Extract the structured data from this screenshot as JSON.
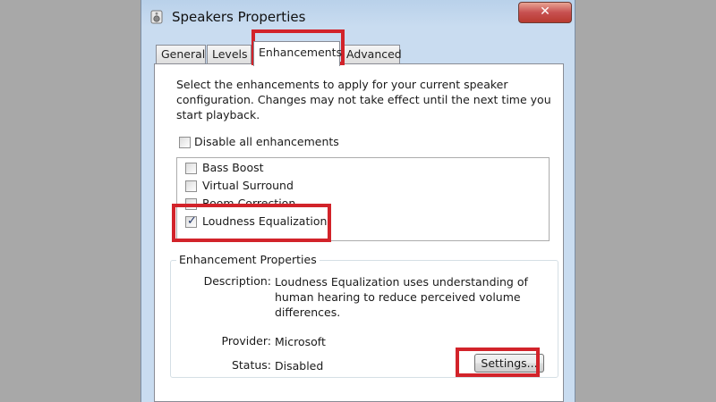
{
  "window": {
    "title": "Speakers Properties",
    "close_glyph": "✕"
  },
  "tabs": [
    {
      "label": "General",
      "active": false
    },
    {
      "label": "Levels",
      "active": false
    },
    {
      "label": "Enhancements",
      "active": true
    },
    {
      "label": "Advanced",
      "active": false
    }
  ],
  "intro_text": "Select the enhancements to apply for your current speaker configuration. Changes may not take effect until the next time you start playback.",
  "disable_all": {
    "label": "Disable all enhancements",
    "checked": false
  },
  "enhancements": [
    {
      "label": "Bass Boost",
      "checked": false
    },
    {
      "label": "Virtual Surround",
      "checked": false
    },
    {
      "label": "Room Correction",
      "checked": false
    },
    {
      "label": "Loudness Equalization",
      "checked": true
    }
  ],
  "properties": {
    "group_title": "Enhancement Properties",
    "description_label": "Description:",
    "description_value": "Loudness Equalization uses understanding of human hearing to reduce perceived volume differences.",
    "provider_label": "Provider:",
    "provider_value": "Microsoft",
    "status_label": "Status:",
    "status_value": "Disabled",
    "settings_button": "Settings..."
  },
  "icons": {
    "speaker": "speaker-icon",
    "checkmark": "✓"
  },
  "colors": {
    "highlight": "#d2232a",
    "title_bar": "#c9dcf0",
    "close_button": "#c75050"
  }
}
